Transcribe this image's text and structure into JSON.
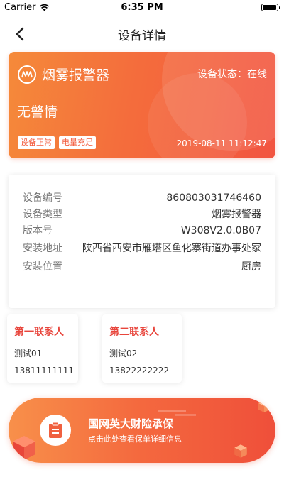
{
  "status_bar": {
    "carrier": "Carrier",
    "time": "6:35 PM",
    "battery_level": 0.95
  },
  "nav": {
    "title": "设备详情"
  },
  "hero": {
    "device_name": "烟雾报警器",
    "status_label": "设备状态：在线",
    "alarm_text": "无警情",
    "tags": [
      "设备正常",
      "电量充足"
    ],
    "timestamp": "2019-08-11 11:12:47"
  },
  "info": {
    "rows": [
      {
        "label": "设备编号",
        "value": "860803031746460"
      },
      {
        "label": "设备类型",
        "value": "烟雾报警器"
      },
      {
        "label": "版本号",
        "value": "W308V2.0.0B07"
      },
      {
        "label": "安装地址",
        "value": "陕西省西安市雁塔区鱼化寨街道办事处家"
      },
      {
        "label": "安装位置",
        "value": "厨房"
      }
    ]
  },
  "contacts": [
    {
      "title": "第一联系人",
      "name": "测试01",
      "phone": "13811111111"
    },
    {
      "title": "第二联系人",
      "name": "测试02",
      "phone": "13822222222"
    }
  ],
  "banner": {
    "title": "国网英大财险承保",
    "subtitle": "点击此处查看保单详细信息"
  },
  "colors": {
    "accent": "#f46d3c",
    "contact_title": "#e8453c"
  }
}
